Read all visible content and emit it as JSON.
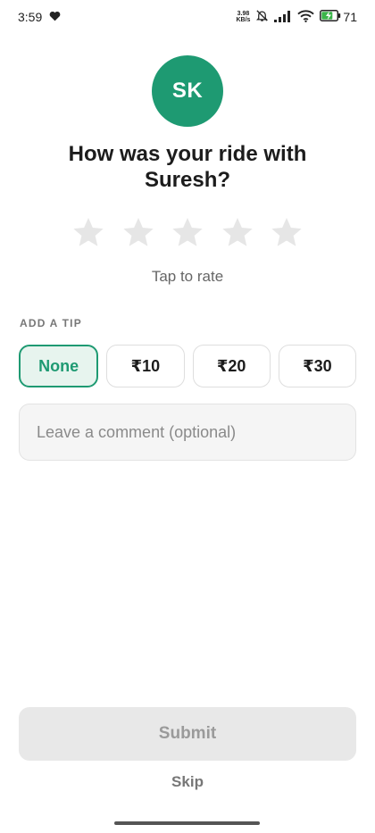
{
  "status_bar": {
    "time": "3:59",
    "net_speed_value": "3.98",
    "net_speed_unit": "KB/s",
    "battery_percent": "71"
  },
  "driver": {
    "initials": "SK",
    "avatar_color": "#1e9a72"
  },
  "rating": {
    "title": "How was your ride with Suresh?",
    "star_count": 5,
    "selected_stars": 0,
    "hint": "Tap to rate"
  },
  "tip": {
    "label": "ADD A TIP",
    "options": [
      "None",
      "₹10",
      "₹20",
      "₹30"
    ],
    "selected": "None"
  },
  "comment": {
    "placeholder": "Leave a comment (optional)",
    "value": ""
  },
  "actions": {
    "submit_label": "Submit",
    "skip_label": "Skip"
  },
  "colors": {
    "accent": "#1e9a72",
    "star_empty": "#e6e6e6",
    "disabled_bg": "#e8e8e8"
  }
}
